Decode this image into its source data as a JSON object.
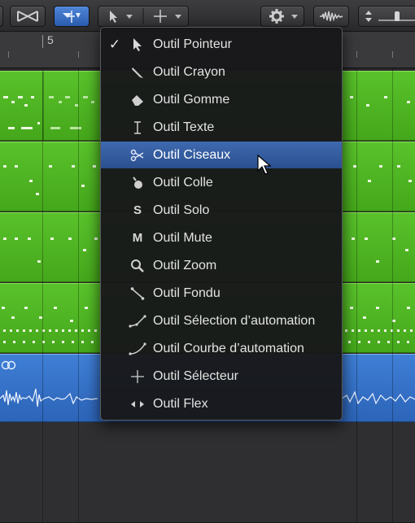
{
  "ruler": {
    "bar_number": "5"
  },
  "toolbar": {
    "icons": [
      "crossfade-tool-icon",
      "marquee-tool-icon",
      "pointer-tool-icon",
      "selector-tool-icon",
      "gear-icon",
      "waveform-icon",
      "zoom-slider-icon"
    ]
  },
  "menu": {
    "items": [
      {
        "label": "Outil Pointeur",
        "icon": "pointer-icon",
        "checked": true
      },
      {
        "label": "Outil Crayon",
        "icon": "pencil-icon"
      },
      {
        "label": "Outil Gomme",
        "icon": "eraser-icon"
      },
      {
        "label": "Outil Texte",
        "icon": "text-cursor-icon"
      },
      {
        "label": "Outil Ciseaux",
        "icon": "scissors-icon",
        "highlighted": true
      },
      {
        "label": "Outil Colle",
        "icon": "glue-icon"
      },
      {
        "label": "Outil Solo",
        "icon": "solo-icon",
        "glyph": "S"
      },
      {
        "label": "Outil Mute",
        "icon": "mute-icon",
        "glyph": "M"
      },
      {
        "label": "Outil Zoom",
        "icon": "magnifier-icon"
      },
      {
        "label": "Outil Fondu",
        "icon": "fade-icon"
      },
      {
        "label": "Outil Sélection d’automation",
        "icon": "automation-select-icon"
      },
      {
        "label": "Outil Courbe d’automation",
        "icon": "automation-curve-icon"
      },
      {
        "label": "Outil Sélecteur",
        "icon": "crosshair-icon"
      },
      {
        "label": "Outil Flex",
        "icon": "flex-icon"
      }
    ],
    "check_mark": "✓"
  },
  "colors": {
    "midi_region": "#52b825",
    "audio_region": "#3674c8",
    "menu_highlight": "#345ea0",
    "menu_bg": "#18181a"
  }
}
